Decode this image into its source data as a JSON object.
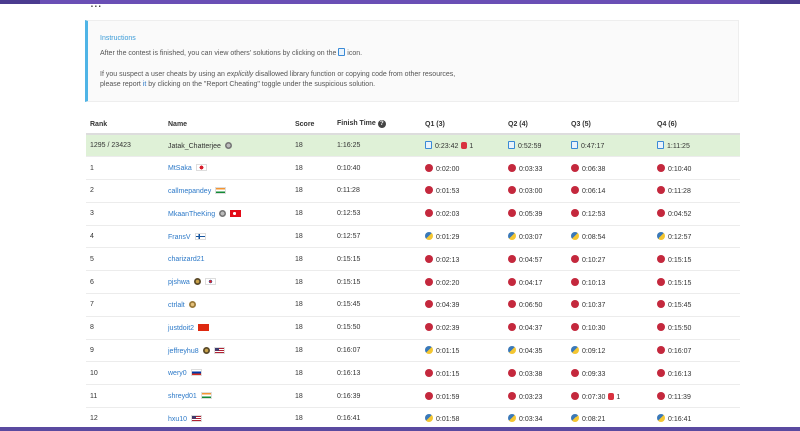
{
  "colors": {
    "accent": "#2c79c8",
    "instructions_border": "#4fb4e6",
    "highlight_row": "#dff1d7",
    "topbar": "#6a4fb5"
  },
  "heading_peek": "...",
  "instructions": {
    "title": "Instructions",
    "p1_before": "After the contest is finished, you can view others' solutions by clicking on the",
    "p1_after": "icon.",
    "p2_a": "If you suspect a user cheats by using an",
    "p2_em": "explicitly",
    "p2_b": "disallowed library function or copying code from other resources,",
    "p2_c": "please report",
    "p2_link": "it",
    "p2_d": "by clicking on the \"Report Cheating\" toggle under the suspicious solution."
  },
  "table": {
    "headers": {
      "rank": "Rank",
      "name": "Name",
      "score": "Score",
      "finish": "Finish Time",
      "q1": "Q1 (3)",
      "q2": "Q2 (4)",
      "q3": "Q3 (5)",
      "q4": "Q4 (6)"
    },
    "rows": [
      {
        "rank": "1295 / 23423",
        "name": "Jatak_Chatterjee",
        "score": "18",
        "finish": "1:16:25",
        "q1": "0:23:42",
        "q1_bug": "1",
        "q2": "0:52:59",
        "q3": "0:47:17",
        "q4": "1:11:25"
      },
      {
        "rank": "1",
        "name": "MtSaka",
        "score": "18",
        "finish": "0:10:40",
        "q1": "0:02:00",
        "q2": "0:03:33",
        "q3": "0:06:38",
        "q4": "0:10:40"
      },
      {
        "rank": "2",
        "name": "callmepandey",
        "score": "18",
        "finish": "0:11:28",
        "q1": "0:01:53",
        "q2": "0:03:00",
        "q3": "0:06:14",
        "q4": "0:11:28"
      },
      {
        "rank": "3",
        "name": "MkaanTheKing",
        "score": "18",
        "finish": "0:12:53",
        "q1": "0:02:03",
        "q2": "0:05:39",
        "q3": "0:12:53",
        "q4": "0:04:52"
      },
      {
        "rank": "4",
        "name": "FransV",
        "score": "18",
        "finish": "0:12:57",
        "q1": "0:01:29",
        "q2": "0:03:07",
        "q3": "0:08:54",
        "q4": "0:12:57"
      },
      {
        "rank": "5",
        "name": "charizard21",
        "score": "18",
        "finish": "0:15:15",
        "q1": "0:02:13",
        "q2": "0:04:57",
        "q3": "0:10:27",
        "q4": "0:15:15"
      },
      {
        "rank": "6",
        "name": "pjshwa",
        "score": "18",
        "finish": "0:15:15",
        "q1": "0:02:20",
        "q2": "0:04:17",
        "q3": "0:10:13",
        "q4": "0:15:15"
      },
      {
        "rank": "7",
        "name": "ctrlalt",
        "score": "18",
        "finish": "0:15:45",
        "q1": "0:04:39",
        "q2": "0:06:50",
        "q3": "0:10:37",
        "q4": "0:15:45"
      },
      {
        "rank": "8",
        "name": "justdoit2",
        "score": "18",
        "finish": "0:15:50",
        "q1": "0:02:39",
        "q2": "0:04:37",
        "q3": "0:10:30",
        "q4": "0:15:50"
      },
      {
        "rank": "9",
        "name": "jeffreyhu8",
        "score": "18",
        "finish": "0:16:07",
        "q1": "0:01:15",
        "q2": "0:04:35",
        "q3": "0:09:12",
        "q4": "0:16:07"
      },
      {
        "rank": "10",
        "name": "wery0",
        "score": "18",
        "finish": "0:16:13",
        "q1": "0:01:15",
        "q2": "0:03:38",
        "q3": "0:09:33",
        "q4": "0:16:13"
      },
      {
        "rank": "11",
        "name": "shreyd01",
        "score": "18",
        "finish": "0:16:39",
        "q1": "0:01:59",
        "q2": "0:03:23",
        "q3": "0:07:30",
        "q3_bug": "1",
        "q4": "0:11:39"
      },
      {
        "rank": "12",
        "name": "hxu10",
        "score": "18",
        "finish": "0:16:41",
        "q1": "0:01:58",
        "q2": "0:03:34",
        "q3": "0:08:21",
        "q4": "0:16:41"
      }
    ]
  }
}
